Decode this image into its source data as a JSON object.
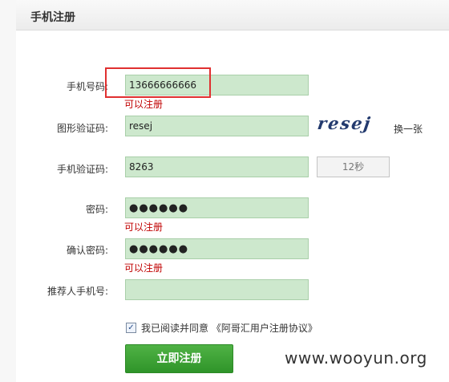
{
  "header": {
    "title": "手机注册"
  },
  "form": {
    "phone": {
      "label": "手机号码:",
      "value": "13666666666",
      "hint": "可以注册"
    },
    "captcha": {
      "label": "图形验证码:",
      "value": "resej",
      "image_text": "resej",
      "refresh_label": "换一张"
    },
    "sms": {
      "label": "手机验证码:",
      "value": "8263",
      "button_label": "12秒"
    },
    "password": {
      "label": "密码:",
      "value": "●●●●●●",
      "hint": "可以注册"
    },
    "confirm": {
      "label": "确认密码:",
      "value": "●●●●●●",
      "hint": "可以注册"
    },
    "referrer": {
      "label": "推荐人手机号:",
      "value": ""
    }
  },
  "agreement": {
    "checked": true,
    "check_glyph": "✓",
    "text": "我已阅读并同意 《阿哥汇用户注册协议》"
  },
  "submit": {
    "label": "立即注册"
  },
  "watermark": "www.wooyun.org",
  "colors": {
    "field_bg": "#cde8cd",
    "hint": "#c00000",
    "submit": "#3aa336",
    "highlight": "#e03030"
  }
}
